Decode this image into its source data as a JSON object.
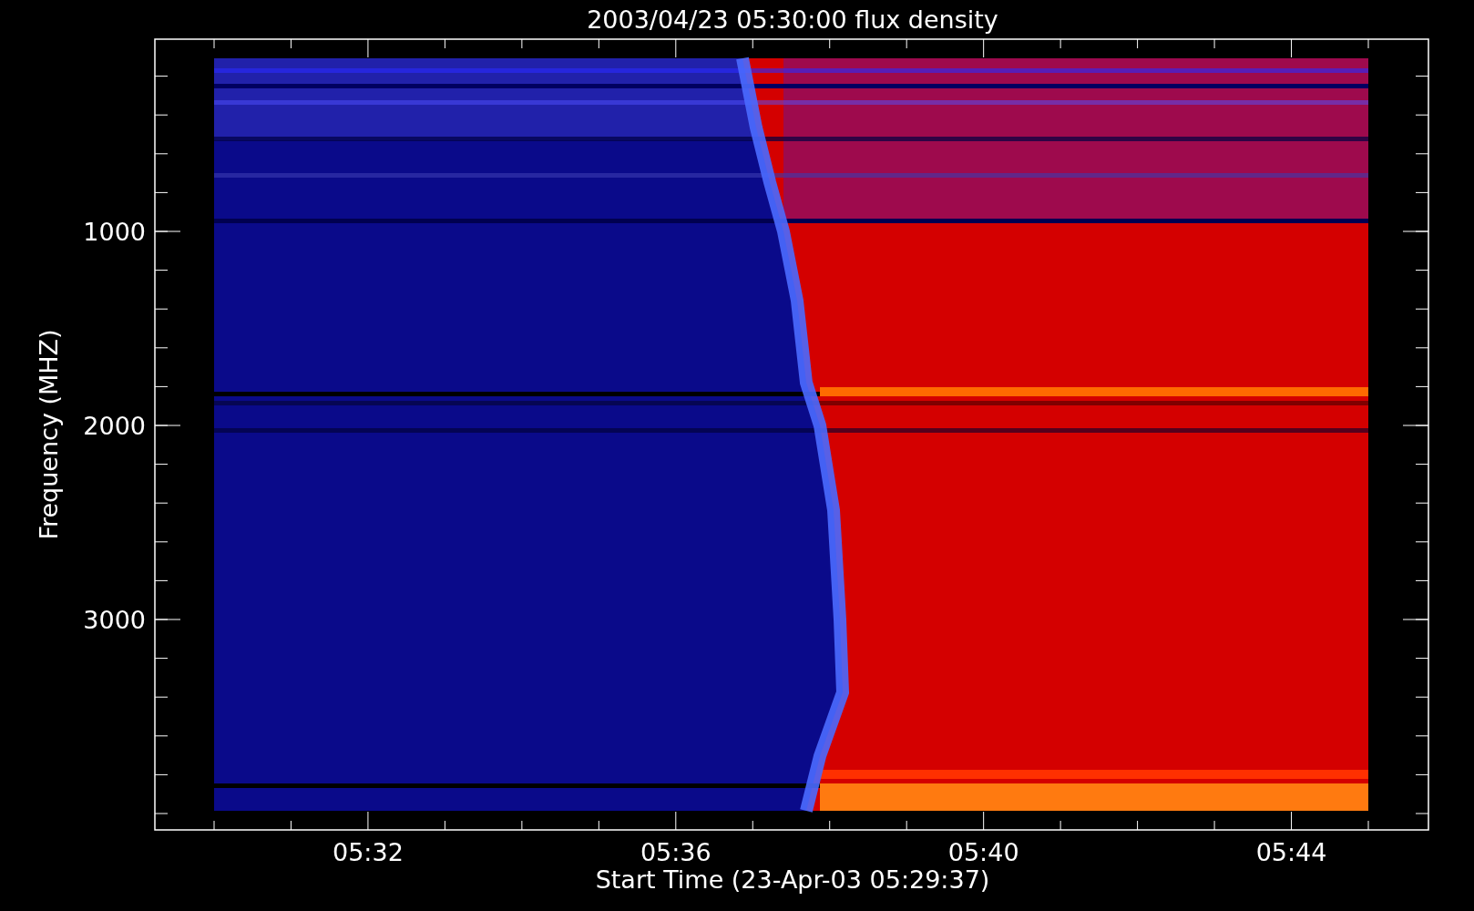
{
  "title": "2003/04/23 05:30:00 flux density",
  "x_axis": {
    "label": "Start Time (23-Apr-03 05:29:37)",
    "ticks": [
      "05:32",
      "05:36",
      "05:40",
      "05:44"
    ]
  },
  "y_axis": {
    "label": "Frequency (MHZ)",
    "ticks": [
      "1000",
      "2000",
      "3000"
    ]
  }
}
